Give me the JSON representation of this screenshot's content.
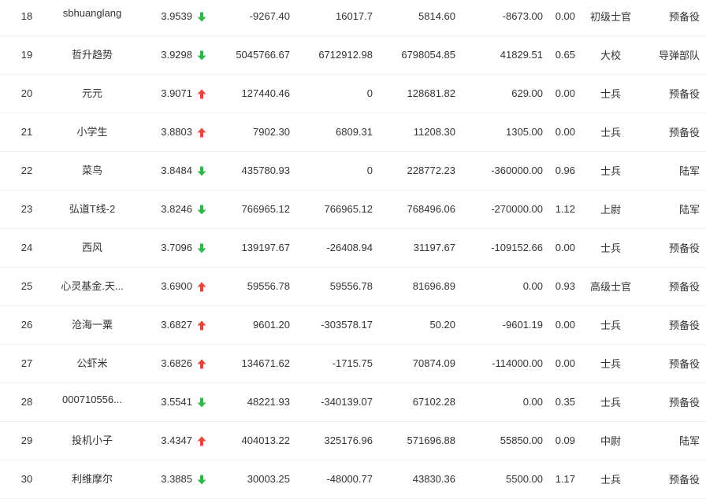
{
  "colors": {
    "up": "#e8443a",
    "down": "#2fb84a",
    "text": "#333333",
    "divider": "#f1f1f1"
  },
  "rows": [
    {
      "rank": "18",
      "name": "sbhuanglang",
      "score": "3.9539",
      "trend": "down",
      "v1": "-9267.40",
      "v2": "16017.7",
      "v3": "5814.60",
      "v4": "-8673.00",
      "ratio": "0.00",
      "title": "初级士官",
      "unit": "预备役"
    },
    {
      "rank": "19",
      "name": "哲升趋势",
      "score": "3.9298",
      "trend": "down",
      "v1": "5045766.67",
      "v2": "6712912.98",
      "v3": "6798054.85",
      "v4": "41829.51",
      "ratio": "0.65",
      "title": "大校",
      "unit": "导弹部队"
    },
    {
      "rank": "20",
      "name": "元元",
      "score": "3.9071",
      "trend": "up",
      "v1": "127440.46",
      "v2": "0",
      "v3": "128681.82",
      "v4": "629.00",
      "ratio": "0.00",
      "title": "士兵",
      "unit": "预备役"
    },
    {
      "rank": "21",
      "name": "小学生",
      "score": "3.8803",
      "trend": "up",
      "v1": "7902.30",
      "v2": "6809.31",
      "v3": "11208.30",
      "v4": "1305.00",
      "ratio": "0.00",
      "title": "士兵",
      "unit": "预备役"
    },
    {
      "rank": "22",
      "name": "菜鸟",
      "score": "3.8484",
      "trend": "down",
      "v1": "435780.93",
      "v2": "0",
      "v3": "228772.23",
      "v4": "-360000.00",
      "ratio": "0.96",
      "title": "士兵",
      "unit": "陆军"
    },
    {
      "rank": "23",
      "name": "弘道T线-2",
      "score": "3.8246",
      "trend": "down",
      "v1": "766965.12",
      "v2": "766965.12",
      "v3": "768496.06",
      "v4": "-270000.00",
      "ratio": "1.12",
      "title": "上尉",
      "unit": "陆军"
    },
    {
      "rank": "24",
      "name": "西风",
      "score": "3.7096",
      "trend": "down",
      "v1": "139197.67",
      "v2": "-26408.94",
      "v3": "31197.67",
      "v4": "-109152.66",
      "ratio": "0.00",
      "title": "士兵",
      "unit": "预备役"
    },
    {
      "rank": "25",
      "name": "心灵基金.天...",
      "score": "3.6900",
      "trend": "up",
      "v1": "59556.78",
      "v2": "59556.78",
      "v3": "81696.89",
      "v4": "0.00",
      "ratio": "0.93",
      "title": "高级士官",
      "unit": "预备役"
    },
    {
      "rank": "26",
      "name": "沧海一粟",
      "score": "3.6827",
      "trend": "up",
      "v1": "9601.20",
      "v2": "-303578.17",
      "v3": "50.20",
      "v4": "-9601.19",
      "ratio": "0.00",
      "title": "士兵",
      "unit": "预备役"
    },
    {
      "rank": "27",
      "name": "公虾米",
      "score": "3.6826",
      "trend": "up",
      "v1": "134671.62",
      "v2": "-1715.75",
      "v3": "70874.09",
      "v4": "-114000.00",
      "ratio": "0.00",
      "title": "士兵",
      "unit": "预备役"
    },
    {
      "rank": "28",
      "name": "000710556...",
      "score": "3.5541",
      "trend": "down",
      "v1": "48221.93",
      "v2": "-340139.07",
      "v3": "67102.28",
      "v4": "0.00",
      "ratio": "0.35",
      "title": "士兵",
      "unit": "预备役"
    },
    {
      "rank": "29",
      "name": "投机小子",
      "score": "3.4347",
      "trend": "up",
      "v1": "404013.22",
      "v2": "325176.96",
      "v3": "571696.88",
      "v4": "55850.00",
      "ratio": "0.09",
      "title": "中尉",
      "unit": "陆军"
    },
    {
      "rank": "30",
      "name": "利维摩尔",
      "score": "3.3885",
      "trend": "down",
      "v1": "30003.25",
      "v2": "-48000.77",
      "v3": "43830.36",
      "v4": "5500.00",
      "ratio": "1.17",
      "title": "士兵",
      "unit": "预备役"
    }
  ]
}
